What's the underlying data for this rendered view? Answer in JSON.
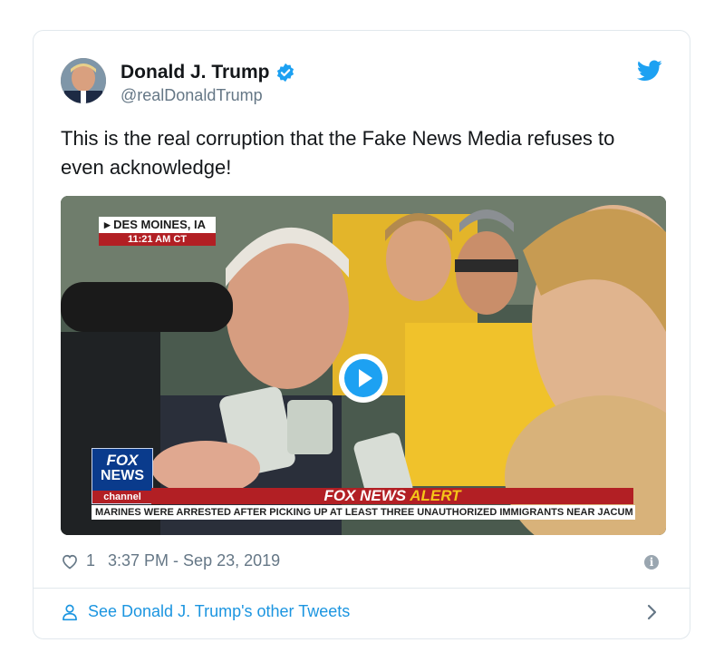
{
  "author": {
    "name": "Donald J. Trump",
    "handle": "@realDonaldTrump"
  },
  "tweet": {
    "text": "This is the real corruption that the Fake News Media refuses to even acknowledge!"
  },
  "video": {
    "location": "DES MOINES, IA",
    "time": "11:21 AM CT",
    "network_line1": "FOX",
    "network_line2": "NEWS",
    "network_line3": "channel",
    "alert_white": "FOX NEWS",
    "alert_yellow": "ALERT",
    "ticker": "MARINES WERE ARRESTED AFTER PICKING UP AT LEAST THREE UNAUTHORIZED IMMIGRANTS NEAR JACUM"
  },
  "meta": {
    "likes": "1",
    "timestamp": "3:37 PM - Sep 23, 2019"
  },
  "footer": {
    "link": "See Donald J. Trump's other Tweets"
  },
  "colors": {
    "link": "#1b95e0",
    "verified": "#1da1f2",
    "alert_red": "#b21f24"
  },
  "icons": [
    "verified-badge-icon",
    "twitter-bird-icon",
    "play-icon",
    "heart-icon",
    "info-icon",
    "person-icon",
    "chevron-right-icon"
  ]
}
